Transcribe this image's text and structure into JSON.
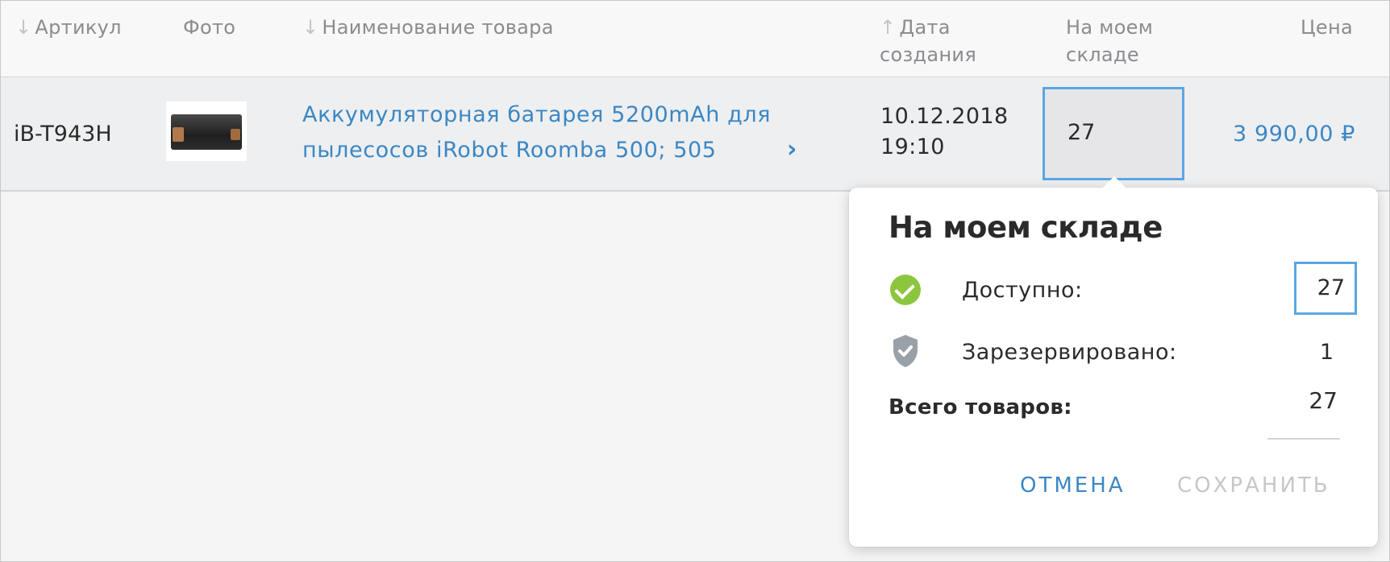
{
  "table": {
    "headers": {
      "article": "Артикул",
      "photo": "Фото",
      "name": "Наименование товара",
      "date": "Дата создания",
      "stock": "На моем складе",
      "price": "Цена"
    },
    "sort_icons": {
      "article": "arrow-down-icon",
      "name": "arrow-down-icon",
      "date": "arrow-up-icon"
    },
    "row": {
      "article": "iB-T943H",
      "photo_alt": "battery-image",
      "name": "Аккумуляторная батарея 5200mAh для пылесосов iRobot  Roomba 500; 505",
      "date": "10.12.2018",
      "time": "19:10",
      "stock": "27",
      "price": "3 990,00 ₽"
    }
  },
  "popover": {
    "title": "На моем складе",
    "available_label": "Доступно:",
    "available_value": "27",
    "reserved_label": "Зарезервировано:",
    "reserved_value": "1",
    "total_label": "Всего товаров:",
    "total_value": "27",
    "cancel_label": "ОТМЕНА",
    "save_label": "СОХРАНИТЬ"
  },
  "colors": {
    "link": "#3b87c4",
    "focus_border": "#5aa7e4",
    "check_green": "#8cc63f",
    "shield_gray": "#9aa0a8",
    "disabled": "#c6c7c9"
  }
}
